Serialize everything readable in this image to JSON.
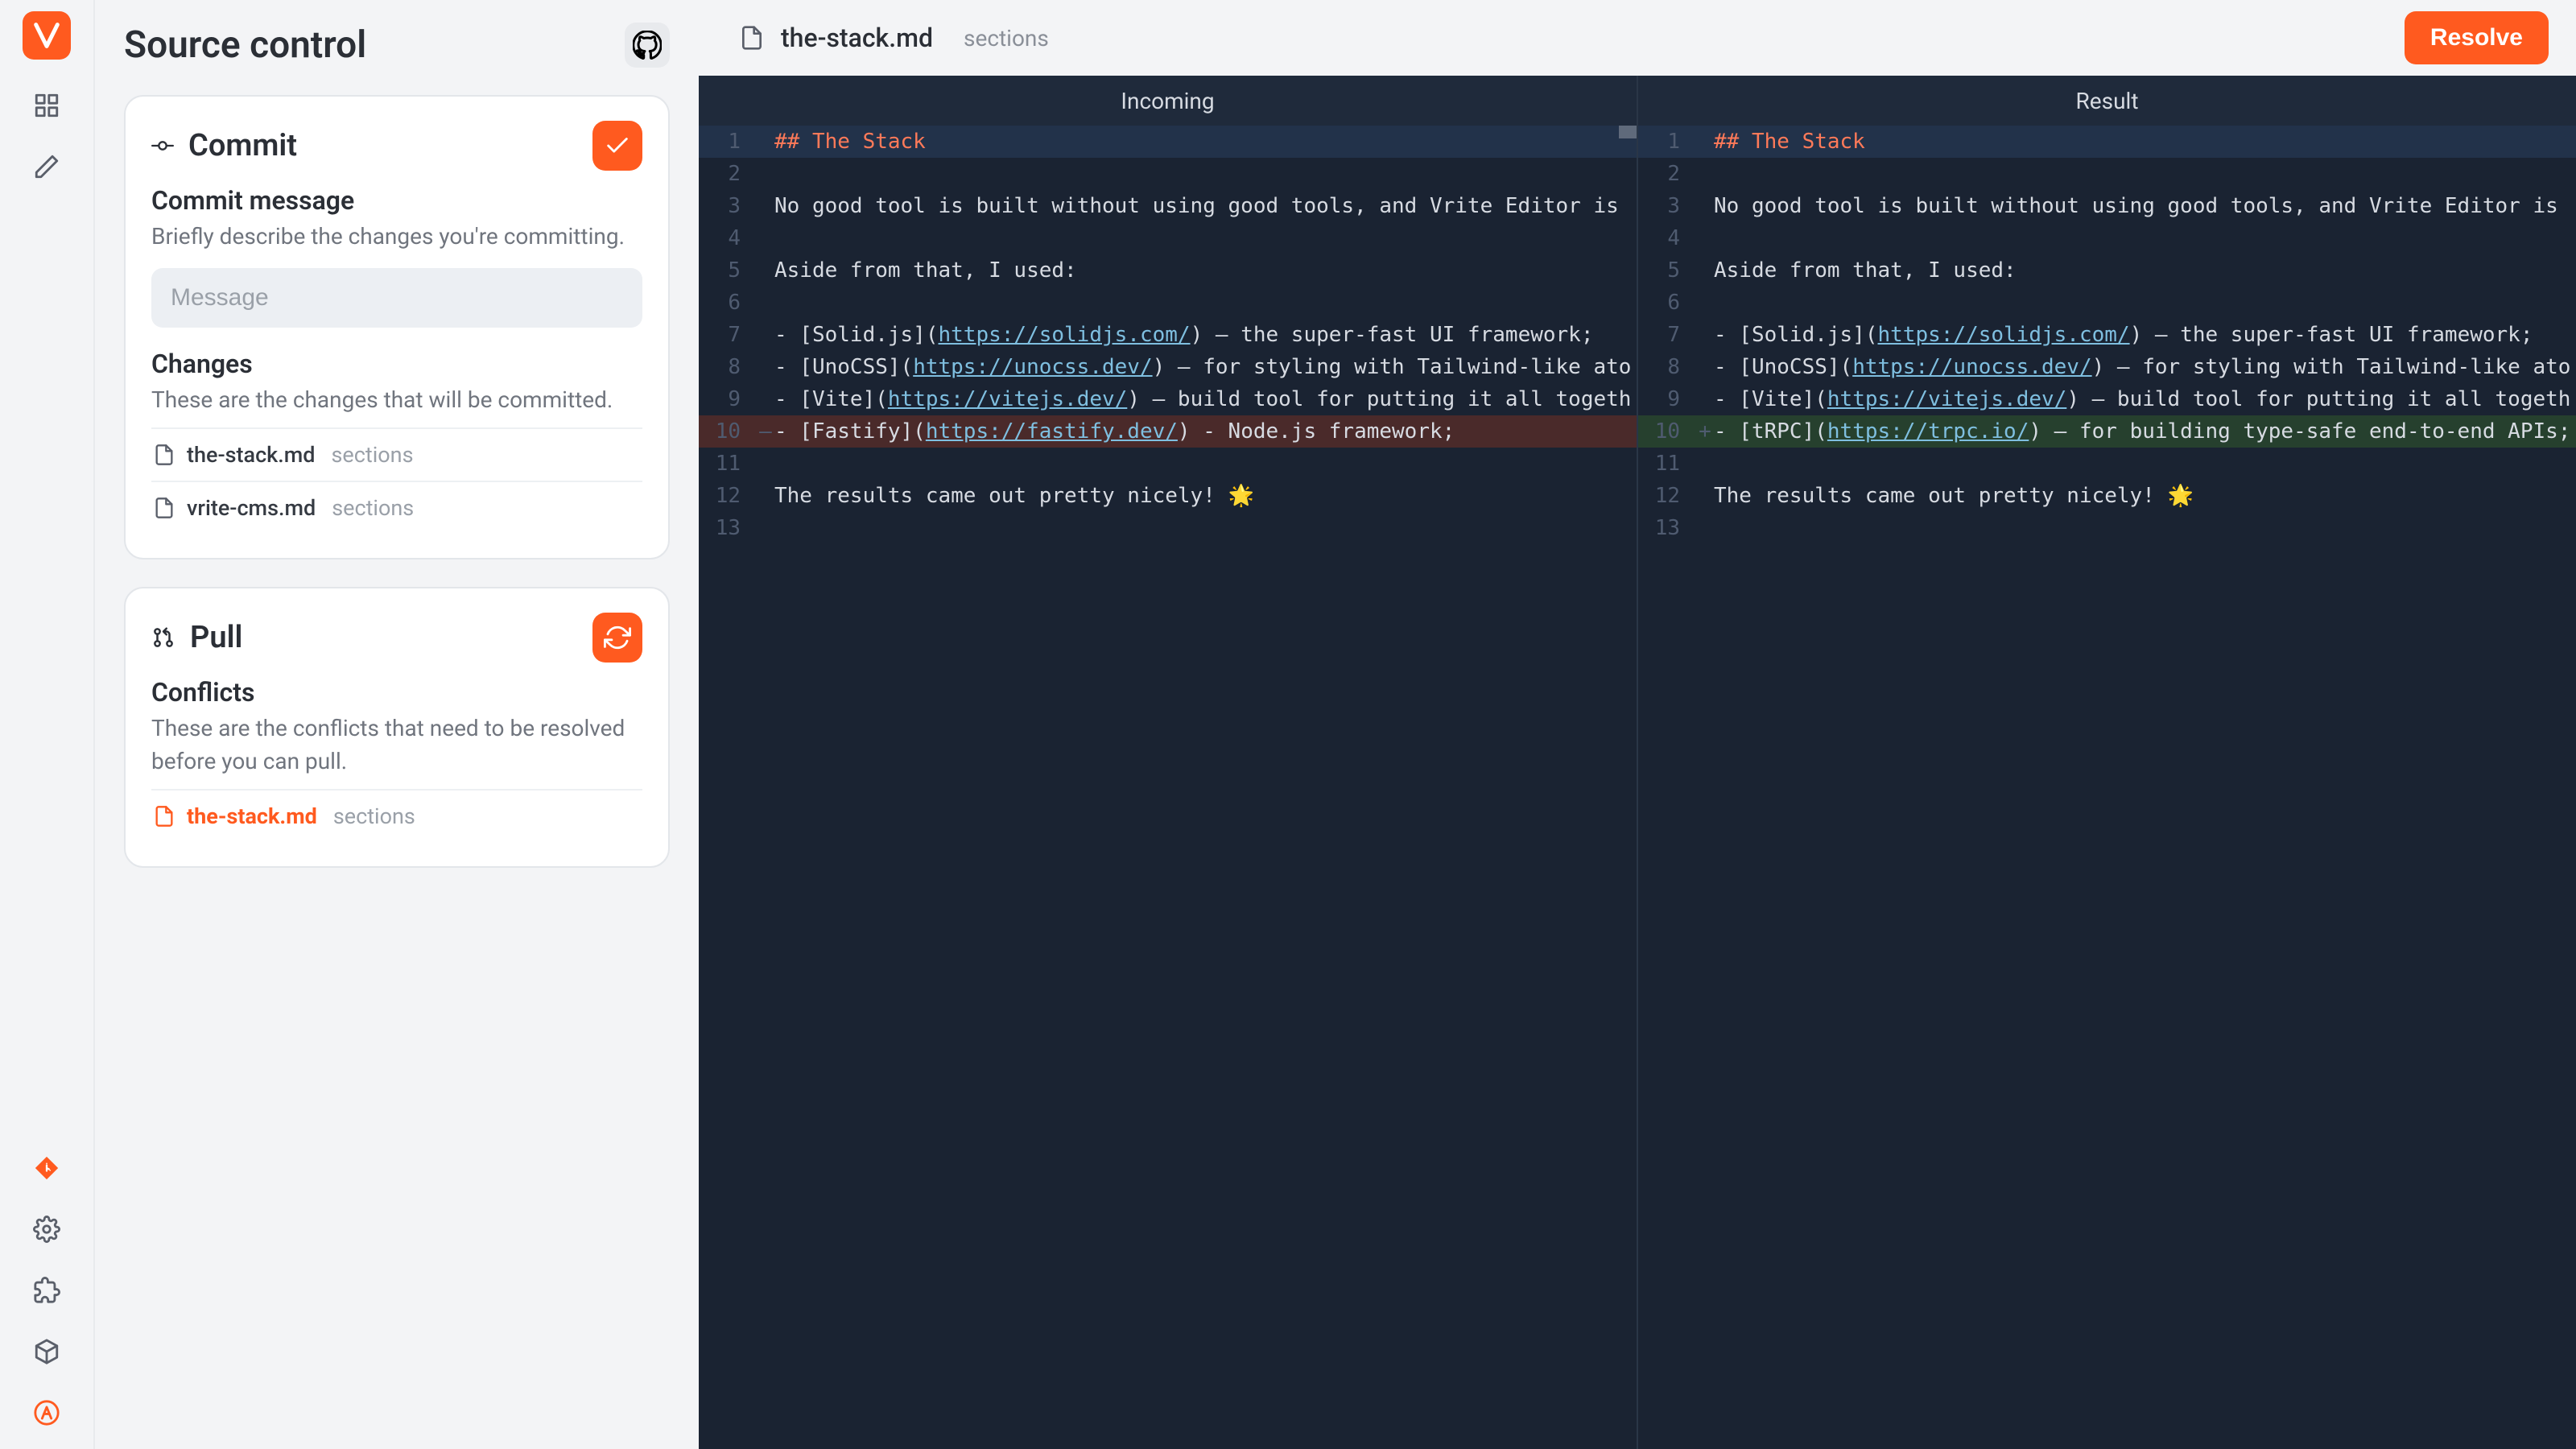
{
  "sidebar": {
    "title": "Source control",
    "commit": {
      "title": "Commit",
      "msg_heading": "Commit message",
      "msg_desc": "Briefly describe the changes you're committing.",
      "msg_placeholder": "Message",
      "changes_heading": "Changes",
      "changes_desc": "These are the changes that will be committed.",
      "files": [
        {
          "name": "the-stack.md",
          "path": "sections"
        },
        {
          "name": "vrite-cms.md",
          "path": "sections"
        }
      ]
    },
    "pull": {
      "title": "Pull",
      "conflicts_heading": "Conflicts",
      "conflicts_desc": "These are the conflicts that need to be resolved before you can pull.",
      "files": [
        {
          "name": "the-stack.md",
          "path": "sections"
        }
      ]
    }
  },
  "topbar": {
    "file": "the-stack.md",
    "path": "sections",
    "resolve": "Resolve"
  },
  "tabs": {
    "incoming": "Incoming",
    "result": "Result"
  },
  "diff": {
    "incoming": [
      {
        "n": 1,
        "cls": "row-sel",
        "html": "<span class='tok-head'>## The Stack</span>"
      },
      {
        "n": 2,
        "cls": "",
        "html": ""
      },
      {
        "n": 3,
        "cls": "",
        "html": "No good tool is built without using good tools, and Vrite Editor is "
      },
      {
        "n": 4,
        "cls": "",
        "html": ""
      },
      {
        "n": 5,
        "cls": "",
        "html": "Aside from that, I used:"
      },
      {
        "n": 6,
        "cls": "",
        "html": ""
      },
      {
        "n": 7,
        "cls": "",
        "html": "- [Solid.js](<span class='tok-link'>https://solidjs.com/</span>) — the super-fast UI framework;"
      },
      {
        "n": 8,
        "cls": "",
        "html": "- [UnoCSS](<span class='tok-link'>https://unocss.dev/</span>) — for styling with Tailwind-like ato"
      },
      {
        "n": 9,
        "cls": "",
        "html": "- [Vite](<span class='tok-link'>https://vitejs.dev/</span>) — build tool for putting it all togeth"
      },
      {
        "n": 10,
        "cls": "row-del",
        "gut": "—",
        "html": "- [Fastify](<span class='tok-link'>https://fastify.dev/</span>) - Node.js framework;"
      },
      {
        "n": 11,
        "cls": "",
        "html": ""
      },
      {
        "n": 12,
        "cls": "",
        "html": "The results came out pretty nicely! 🌟"
      },
      {
        "n": 13,
        "cls": "",
        "html": ""
      }
    ],
    "result": [
      {
        "n": 1,
        "cls": "row-sel",
        "html": "<span class='tok-head'>## The Stack</span>"
      },
      {
        "n": 2,
        "cls": "",
        "html": ""
      },
      {
        "n": 3,
        "cls": "",
        "html": "No good tool is built without using good tools, and Vrite Editor is "
      },
      {
        "n": 4,
        "cls": "",
        "html": ""
      },
      {
        "n": 5,
        "cls": "",
        "html": "Aside from that, I used:"
      },
      {
        "n": 6,
        "cls": "",
        "html": ""
      },
      {
        "n": 7,
        "cls": "",
        "html": "- [Solid.js](<span class='tok-link'>https://solidjs.com/</span>) — the super-fast UI framework;"
      },
      {
        "n": 8,
        "cls": "",
        "html": "- [UnoCSS](<span class='tok-link'>https://unocss.dev/</span>) — for styling with Tailwind-like ato"
      },
      {
        "n": 9,
        "cls": "",
        "html": "- [Vite](<span class='tok-link'>https://vitejs.dev/</span>) — build tool for putting it all togeth"
      },
      {
        "n": 10,
        "cls": "row-add",
        "gut": "+",
        "html": "- [tRPC](<span class='tok-link'>https://trpc.io/</span>) — for building type-safe end-to-end APIs;"
      },
      {
        "n": 11,
        "cls": "",
        "html": ""
      },
      {
        "n": 12,
        "cls": "",
        "html": "The results came out pretty nicely! 🌟"
      },
      {
        "n": 13,
        "cls": "",
        "html": ""
      }
    ]
  }
}
